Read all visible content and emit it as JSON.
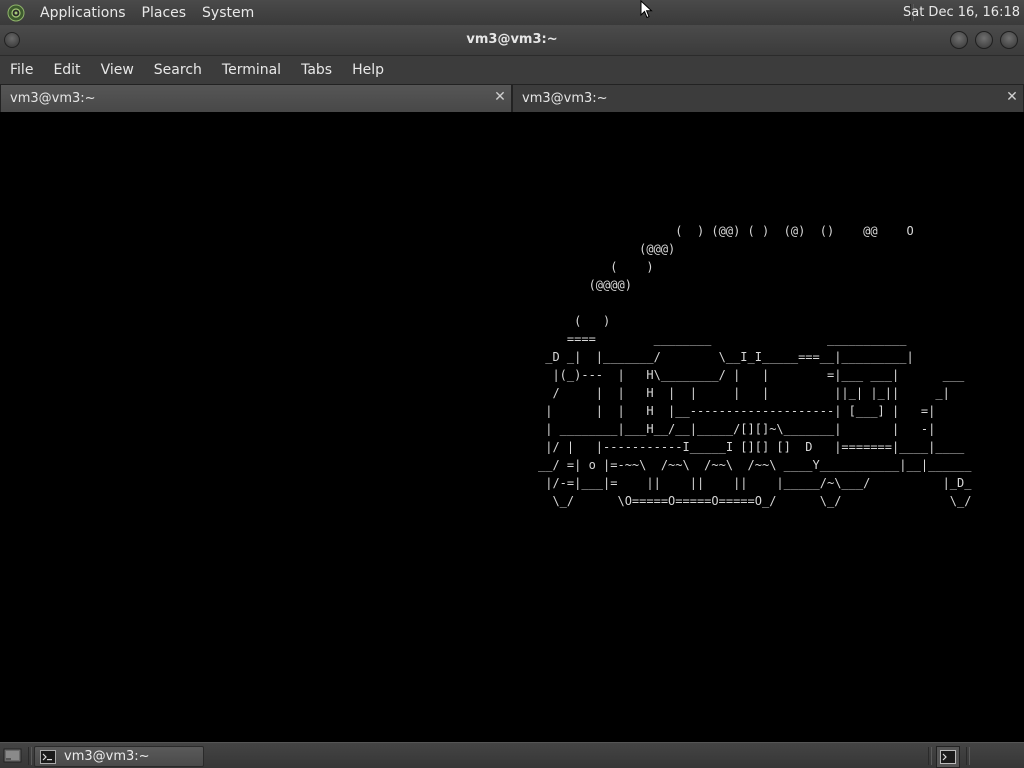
{
  "top_panel": {
    "menus": [
      "Applications",
      "Places",
      "System"
    ],
    "clock": "Sat Dec 16, 16:18"
  },
  "window": {
    "title": "vm3@vm3:~"
  },
  "menubar": {
    "items": [
      "File",
      "Edit",
      "View",
      "Search",
      "Terminal",
      "Tabs",
      "Help"
    ]
  },
  "tabs": [
    {
      "label": "vm3@vm3:~",
      "close": "✕"
    },
    {
      "label": "vm3@vm3:~",
      "close": "✕"
    }
  ],
  "terminal": {
    "ascii_art": "                   (  ) (@@) ( )  (@)  ()    @@    O\n              (@@@)\n          (    )\n       (@@@@)\n\n     (   )\n    ====        ________                ___________\n _D _|  |_______/        \\__I_I_____===__|_________|\n  |(_)---  |   H\\________/ |   |        =|___ ___|      ___\n  /     |  |   H  |  |     |   |         ||_| |_||     _|\n |      |  |   H  |__--------------------| [___] |   =|\n | ________|___H__/__|_____/[][]~\\_______|       |   -|\n |/ |   |-----------I_____I [][] []  D   |=======|____|____\n__/ =| o |=-~~\\  /~~\\  /~~\\  /~~\\ ____Y___________|__|______\n |/-=|___|=    ||    ||    ||    |_____/~\\___/          |_D_\n  \\_/      \\O=====O=====O=====O_/      \\_/               \\_/"
  },
  "taskbar": {
    "task_label": "vm3@vm3:~"
  },
  "colors": {
    "panel": "#3c3c3c",
    "terminal_bg": "#000000",
    "terminal_fg": "#d8d8d8"
  },
  "icons": {
    "logo": "gnome-foot-logo-icon",
    "show_desktop": "show-desktop-icon",
    "terminal": "terminal-icon",
    "workspace": "workspace-switcher-icon"
  }
}
